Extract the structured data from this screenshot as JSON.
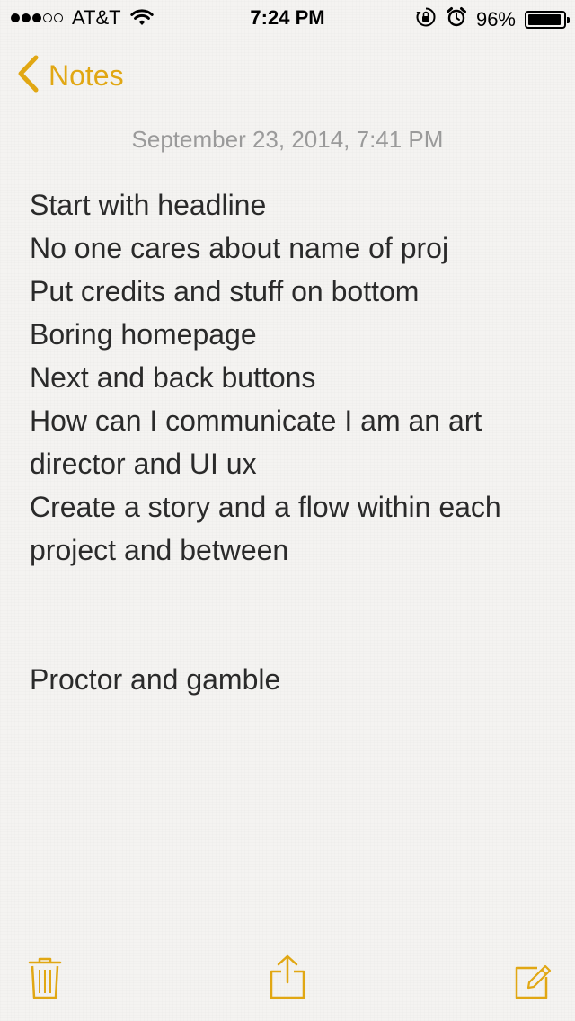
{
  "status_bar": {
    "carrier": "AT&T",
    "time": "7:24 PM",
    "battery_percent": "96%",
    "battery_level": 0.96,
    "signal_bars": 3,
    "signal_total": 5
  },
  "nav": {
    "back_label": "Notes"
  },
  "note": {
    "date": "September 23, 2014, 7:41 PM",
    "lines": [
      "Start with headline",
      "No one cares about name of proj",
      "Put credits and stuff on bottom",
      "Boring homepage",
      "Next and back buttons",
      "How can I communicate I am an art director and UI ux",
      "Create a story and a flow within each project and between",
      "",
      "",
      "Proctor and gamble"
    ]
  },
  "toolbar": {
    "icons": [
      "trash-icon",
      "share-icon",
      "compose-icon"
    ]
  },
  "colors": {
    "accent": "#e1a713",
    "date_text": "#9a9a9a",
    "body_text": "#2a2a2a",
    "background": "#f4f3f1"
  }
}
